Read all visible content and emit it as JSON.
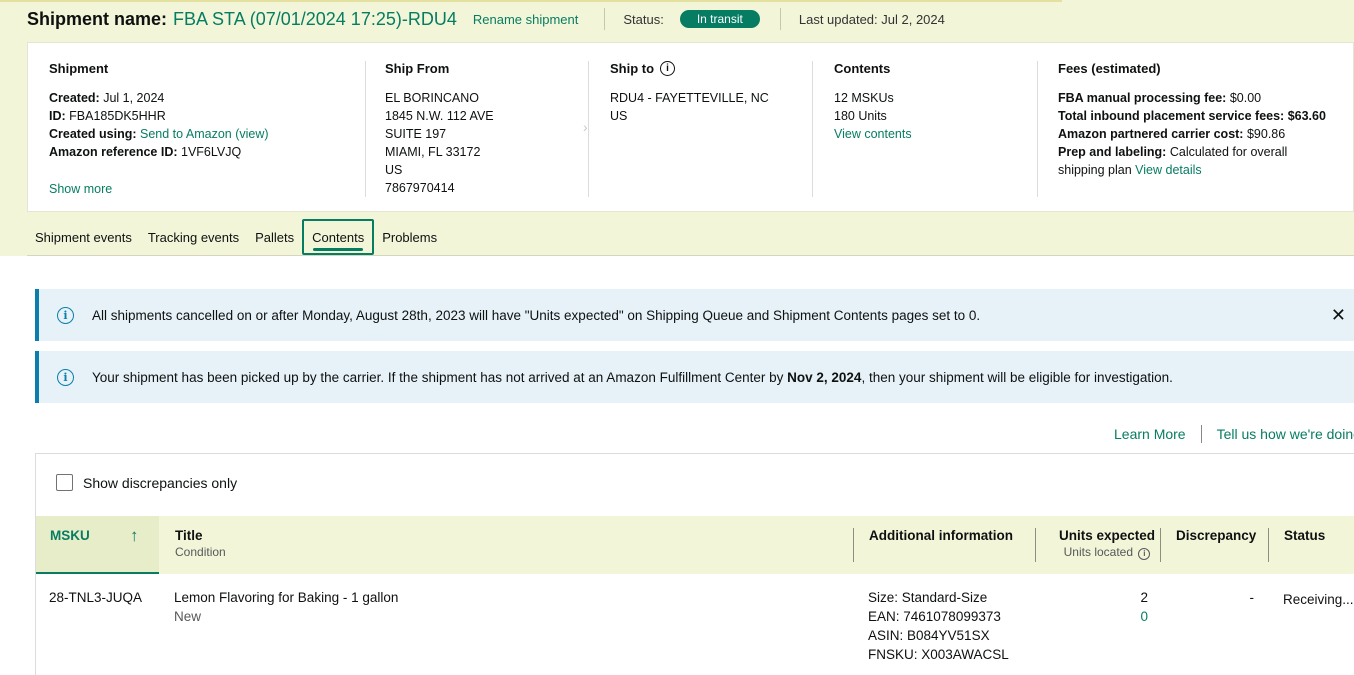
{
  "header": {
    "shipment_label": "Shipment name:",
    "shipment_name": "FBA STA (07/01/2024 17:25)-RDU4",
    "rename_link": "Rename shipment",
    "status_label": "Status:",
    "status_value": "In transit",
    "last_updated": "Last updated: Jul 2, 2024"
  },
  "summary": {
    "shipment": {
      "title": "Shipment",
      "created_label": "Created:",
      "created_value": "Jul 1, 2024",
      "id_label": "ID:",
      "id_value": "FBA185DK5HHR",
      "created_using_label": "Created using:",
      "created_using_value": "Send to Amazon (view)",
      "ref_label": "Amazon reference ID:",
      "ref_value": "1VF6LVJQ",
      "show_more": "Show more"
    },
    "ship_from": {
      "title": "Ship From",
      "lines": [
        "EL BORINCANO",
        "1845 N.W. 112 AVE",
        "SUITE 197",
        "MIAMI, FL 33172",
        "US",
        "7867970414"
      ]
    },
    "ship_to": {
      "title": "Ship to",
      "lines": [
        "RDU4 - FAYETTEVILLE, NC",
        "US"
      ]
    },
    "contents": {
      "title": "Contents",
      "mskus": "12 MSKUs",
      "units": "180 Units",
      "view_link": "View contents"
    },
    "fees": {
      "title": "Fees (estimated)",
      "manual_label": "FBA manual processing fee:",
      "manual_value": "$0.00",
      "placement_label": "Total inbound placement service fees:",
      "placement_value": "$63.60",
      "carrier_label": "Amazon partnered carrier cost:",
      "carrier_value": "$90.86",
      "prep_label": "Prep and labeling:",
      "prep_value": "Calculated for overall",
      "prep_value2": "shipping plan",
      "view_details": "View details"
    }
  },
  "tabs": [
    "Shipment events",
    "Tracking events",
    "Pallets",
    "Contents",
    "Problems"
  ],
  "banners": {
    "cancel_notice": "All shipments cancelled on or after Monday, August 28th, 2023 will have \"Units expected\" on Shipping Queue and Shipment Contents pages set to 0.",
    "pickup_pre": "Your shipment has been picked up by the carrier. If the shipment has not arrived at an Amazon Fulfillment Center by ",
    "pickup_date": "Nov 2, 2024",
    "pickup_post": ", then your shipment will be eligible for investigation."
  },
  "links": {
    "learn_more": "Learn More",
    "tell_us": "Tell us how we're doing"
  },
  "table": {
    "filter_label": "Show discrepancies only",
    "headers": {
      "msku": "MSKU",
      "title": "Title",
      "title_sub": "Condition",
      "additional": "Additional information",
      "units_expected": "Units expected",
      "units_located": "Units located",
      "discrepancy": "Discrepancy",
      "status": "Status"
    },
    "rows": [
      {
        "msku": "28-TNL3-JUQA",
        "title": "Lemon Flavoring for Baking - 1 gallon",
        "condition": "New",
        "size": "Size: Standard-Size",
        "ean": "EAN: 7461078099373",
        "asin": "ASIN: B084YV51SX",
        "fnsku": "FNSKU: X003AWACSL",
        "units_expected": "2",
        "units_located": "0",
        "discrepancy": "-",
        "status": "Receiving..."
      }
    ]
  }
}
